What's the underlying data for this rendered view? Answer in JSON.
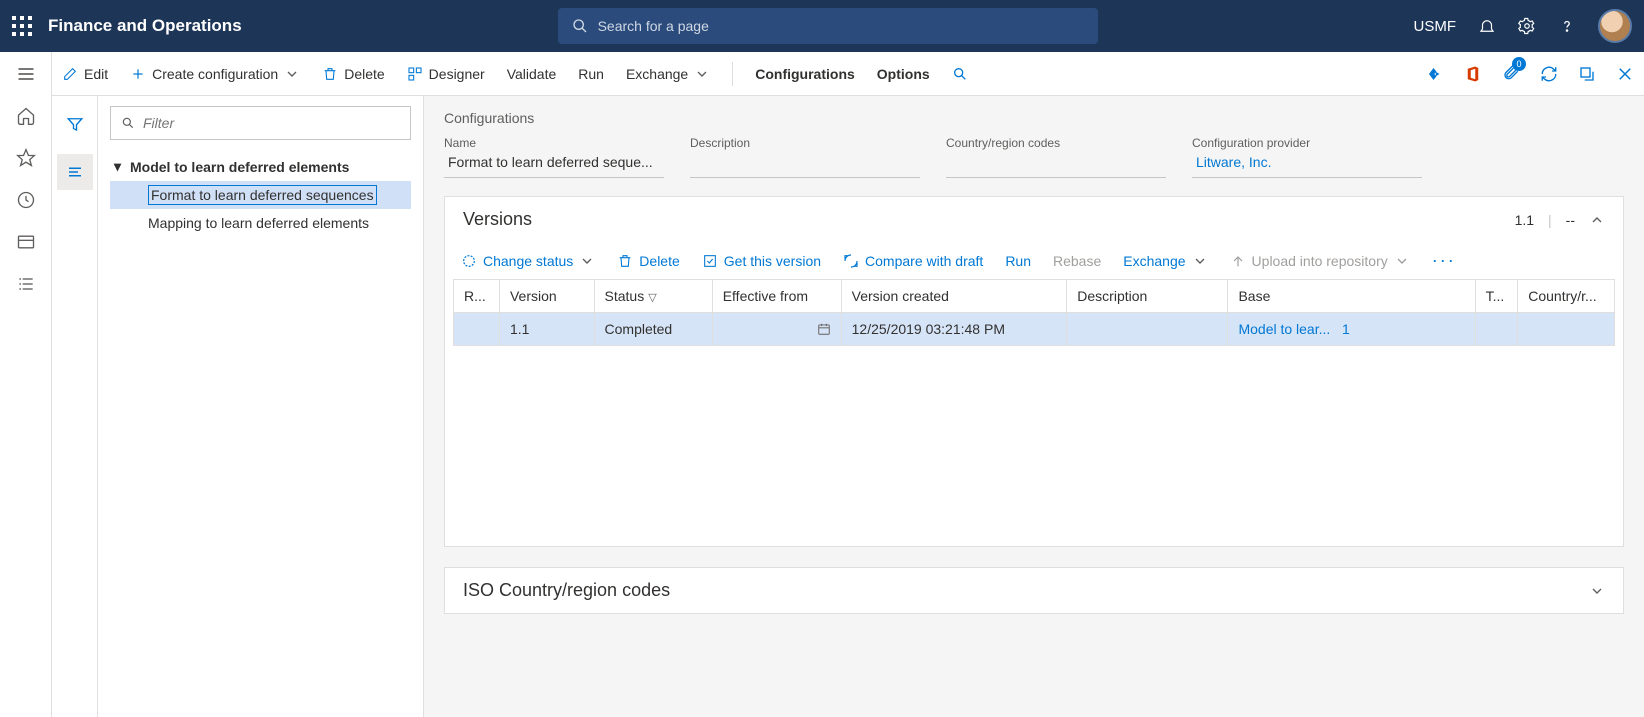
{
  "header": {
    "app_title": "Finance and Operations",
    "search_placeholder": "Search for a page",
    "company": "USMF"
  },
  "cmdbar": {
    "edit": "Edit",
    "create_config": "Create configuration",
    "delete": "Delete",
    "designer": "Designer",
    "validate": "Validate",
    "run": "Run",
    "exchange": "Exchange",
    "configurations": "Configurations",
    "options": "Options",
    "attach_badge": "0"
  },
  "tree": {
    "filter_placeholder": "Filter",
    "parent": "Model to learn deferred elements",
    "children": [
      "Format to learn deferred sequences",
      "Mapping to learn deferred elements"
    ]
  },
  "details": {
    "heading": "Configurations",
    "fields": {
      "name_label": "Name",
      "name_value": "Format to learn deferred seque...",
      "description_label": "Description",
      "description_value": "",
      "country_label": "Country/region codes",
      "country_value": "",
      "provider_label": "Configuration provider",
      "provider_value": "Litware, Inc."
    }
  },
  "versions": {
    "title": "Versions",
    "current": "1.1",
    "dash": "--",
    "toolbar": {
      "change_status": "Change status",
      "delete": "Delete",
      "get_version": "Get this version",
      "compare": "Compare with draft",
      "run": "Run",
      "rebase": "Rebase",
      "exchange": "Exchange",
      "upload": "Upload into repository"
    },
    "columns": {
      "r": "R...",
      "version": "Version",
      "status": "Status",
      "effective": "Effective from",
      "created": "Version created",
      "description": "Description",
      "base": "Base",
      "t": "T...",
      "country": "Country/r..."
    },
    "rows": [
      {
        "version": "1.1",
        "status": "Completed",
        "effective": "",
        "created": "12/25/2019 03:21:48 PM",
        "description": "",
        "base": "Model to lear...",
        "base_num": "1"
      }
    ]
  },
  "iso_panel": {
    "title": "ISO Country/region codes"
  }
}
